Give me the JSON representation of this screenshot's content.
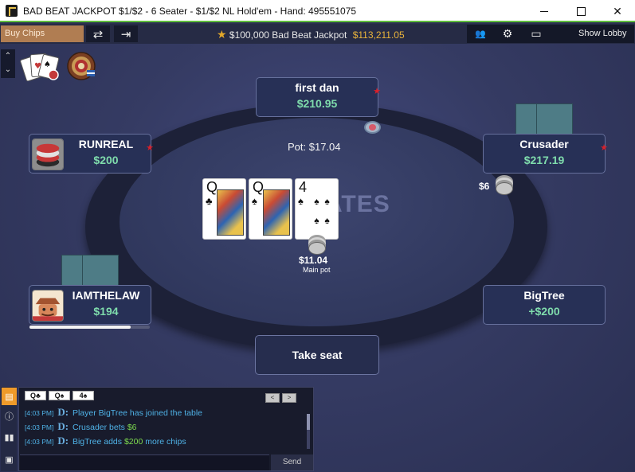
{
  "window": {
    "title": "BAD BEAT JACKPOT $1/$2 - 6 Seater - $1/$2 NL Hold'em - Hand: 495551075",
    "min_icon": "minimize-icon",
    "max_icon": "maximize-icon",
    "close_glyph": "✕"
  },
  "toolbar": {
    "buy_chips": "Buy Chips",
    "rebuy_glyph": "⇄",
    "leave_glyph": "⇥",
    "jackpot_star": "★",
    "jackpot_label": "$100,000 Bad Beat Jackpot",
    "jackpot_amount": "$113,211.05",
    "players_glyph": "👥",
    "settings_glyph": "⚙",
    "layout_glyph": "▭",
    "show_lobby": "Show Lobby"
  },
  "side": {
    "up_glyph": "⌃",
    "down_glyph": "⌄"
  },
  "table": {
    "watermark": "MATES",
    "pot": "Pot: $17.04",
    "main_pot_amount": "$11.04",
    "main_pot_label": "Main pot",
    "bet_amount": "$6",
    "take_seat": "Take seat"
  },
  "board": [
    {
      "rank": "Q",
      "suit": "♣"
    },
    {
      "rank": "Q",
      "suit": "♠"
    },
    {
      "rank": "4",
      "suit": "♠"
    }
  ],
  "seats": {
    "top": {
      "name": "first dan",
      "stack": "$210.95"
    },
    "left_upper": {
      "name": "RUNREAL",
      "stack": "$200"
    },
    "right_upper": {
      "name": "Crusader",
      "stack": "$217.19"
    },
    "left_lower": {
      "name": "IAMTHELAW",
      "stack": "$194",
      "time_remaining": 0.84
    },
    "right_lower": {
      "name": "BigTree",
      "stack": "+$200"
    }
  },
  "chat": {
    "mini_cards": [
      "Q♣",
      "Q♠",
      "4♠"
    ],
    "prev_glyph": "<",
    "next_glyph": ">",
    "lines": [
      {
        "time": "[4:03 PM]",
        "text": "Player BigTree  has joined the table",
        "money": ""
      },
      {
        "time": "[4:03 PM]",
        "text": "Crusader  bets ",
        "money": "$6"
      },
      {
        "time": "[4:03 PM]",
        "text": "BigTree  adds ",
        "money": "$200",
        "suffix": " more chips"
      }
    ],
    "send": "Send",
    "tabs": [
      "chat-icon",
      "info-icon",
      "stats-icon",
      "notes-icon"
    ]
  },
  "colors": {
    "accent_green": "#7fdcac",
    "jackpot_gold": "#e9b33b",
    "chat_blue": "#4fb2e6",
    "active_tab": "#ef9a2a"
  }
}
